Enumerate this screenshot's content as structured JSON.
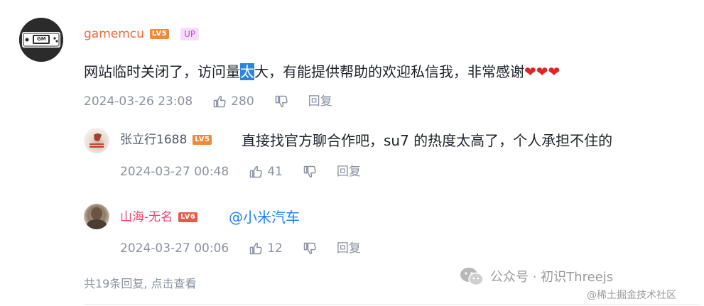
{
  "comment": {
    "username": "gamemcu",
    "level": "LV5",
    "badge": "UP",
    "text_before": "网站临时关闭了，访问量",
    "text_highlight": "太",
    "text_after": "大，有能提供帮助的欢迎私信我，非常感谢",
    "hearts": "❤❤❤",
    "timestamp": "2024-03-26 23:08",
    "likes": "280",
    "reply_label": "回复",
    "avatar_text": "GM"
  },
  "replies": [
    {
      "username": "张立行1688",
      "level": "LV5",
      "text": "直接找官方聊合作吧，su7 的热度太高了，个人承担不住的",
      "timestamp": "2024-03-27 00:48",
      "likes": "41",
      "reply_label": "回复"
    },
    {
      "username": "山海-无名",
      "level": "LV6",
      "text": "@小米汽车",
      "timestamp": "2024-03-27 00:06",
      "likes": "12",
      "reply_label": "回复"
    }
  ],
  "footer": {
    "more_replies": "共19条回复, 点击查看"
  },
  "watermark": {
    "wechat": "公众号 · 初识Threejs",
    "site": "@稀土掘金技术社区"
  },
  "colors": {
    "username_main": "#f0683b",
    "username_reply1": "#515767",
    "username_reply2": "#e8436f",
    "mention": "#1e80ff",
    "meta_gray": "#8a919f"
  },
  "icons": {
    "like": "thumbs-up-icon",
    "dislike": "thumbs-down-icon",
    "watermark": "wechat-logo-icon"
  }
}
